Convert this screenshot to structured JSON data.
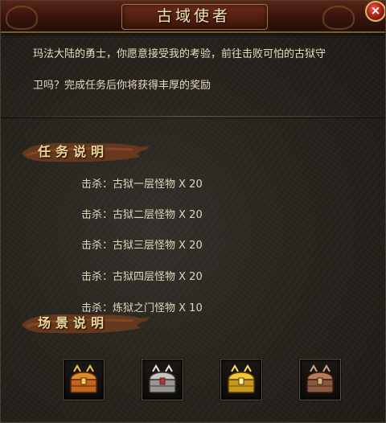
{
  "window": {
    "title": "古域使者",
    "close_label": "×"
  },
  "intro": {
    "line1": "玛法大陆的勇士，你愿意接受我的考验，前往击败可怕的古狱守",
    "line2": "卫吗？完成任务后你将获得丰厚的奖励"
  },
  "task_section": {
    "title": "任务说明",
    "tasks": [
      "击杀：古狱一层怪物 X 20",
      "击杀：古狱二层怪物 X 20",
      "击杀：古狱三层怪物 X 20",
      "击杀：古狱四层怪物 X 20",
      "击杀：炼狱之门怪物 X 10"
    ]
  },
  "scene_section": {
    "title": "场景说明"
  },
  "rewards": [
    {
      "icon": "orange-chest-icon",
      "color": "#d6731c"
    },
    {
      "icon": "silver-chest-icon",
      "color": "#b8b4b0"
    },
    {
      "icon": "gold-chest-icon",
      "color": "#e0b21e"
    },
    {
      "icon": "bronze-chest-icon",
      "color": "#a8694a"
    }
  ],
  "colors": {
    "title_bar": "#3a150d",
    "trim": "#8a6a34",
    "text": "#e7dcc0",
    "section_title": "#f0d89a"
  }
}
